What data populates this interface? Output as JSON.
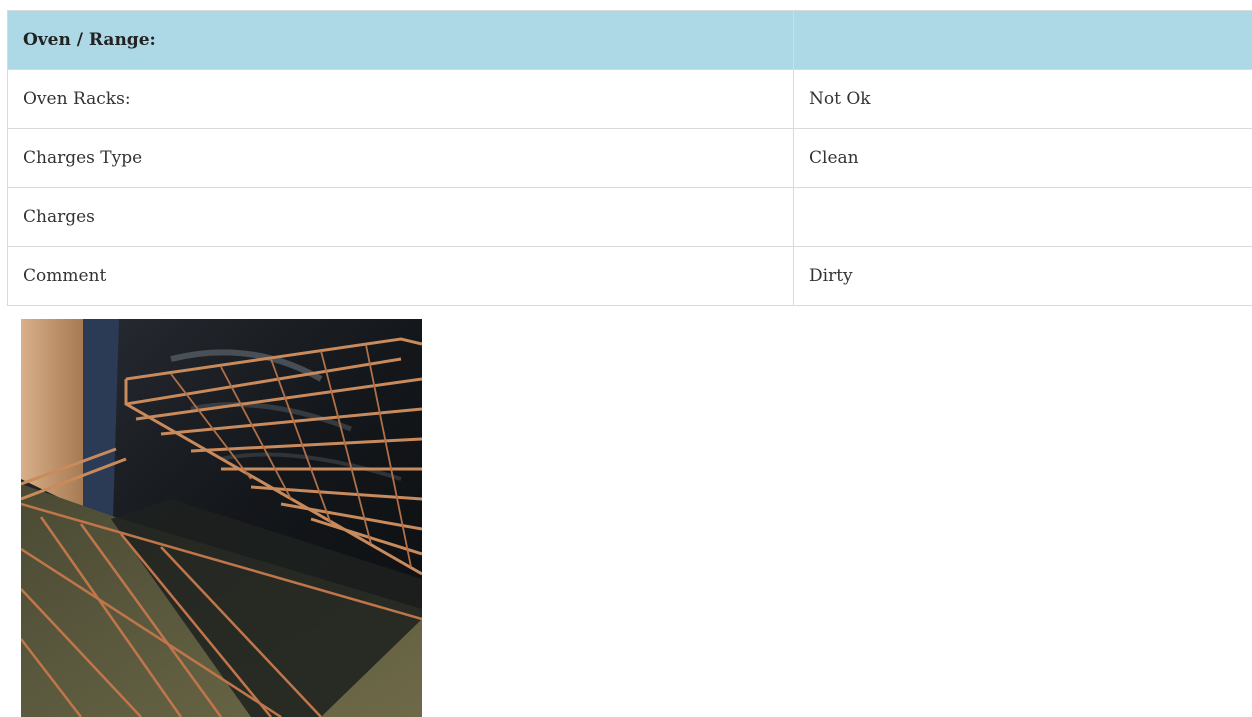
{
  "section": {
    "title": "Oven / Range:",
    "title_value": ""
  },
  "rows": [
    {
      "label": "Oven Racks:",
      "value": "Not Ok"
    },
    {
      "label": "Charges Type",
      "value": "Clean"
    },
    {
      "label": "Charges",
      "value": ""
    },
    {
      "label": "Comment",
      "value": "Dirty"
    }
  ],
  "photo": {
    "subject": "oven-racks-photo",
    "colors": {
      "cabinet": "#c99a6e",
      "oven_wall": "#1a1d22",
      "floor": "#5a5a3c",
      "rack_wire": "#c0764a"
    }
  }
}
